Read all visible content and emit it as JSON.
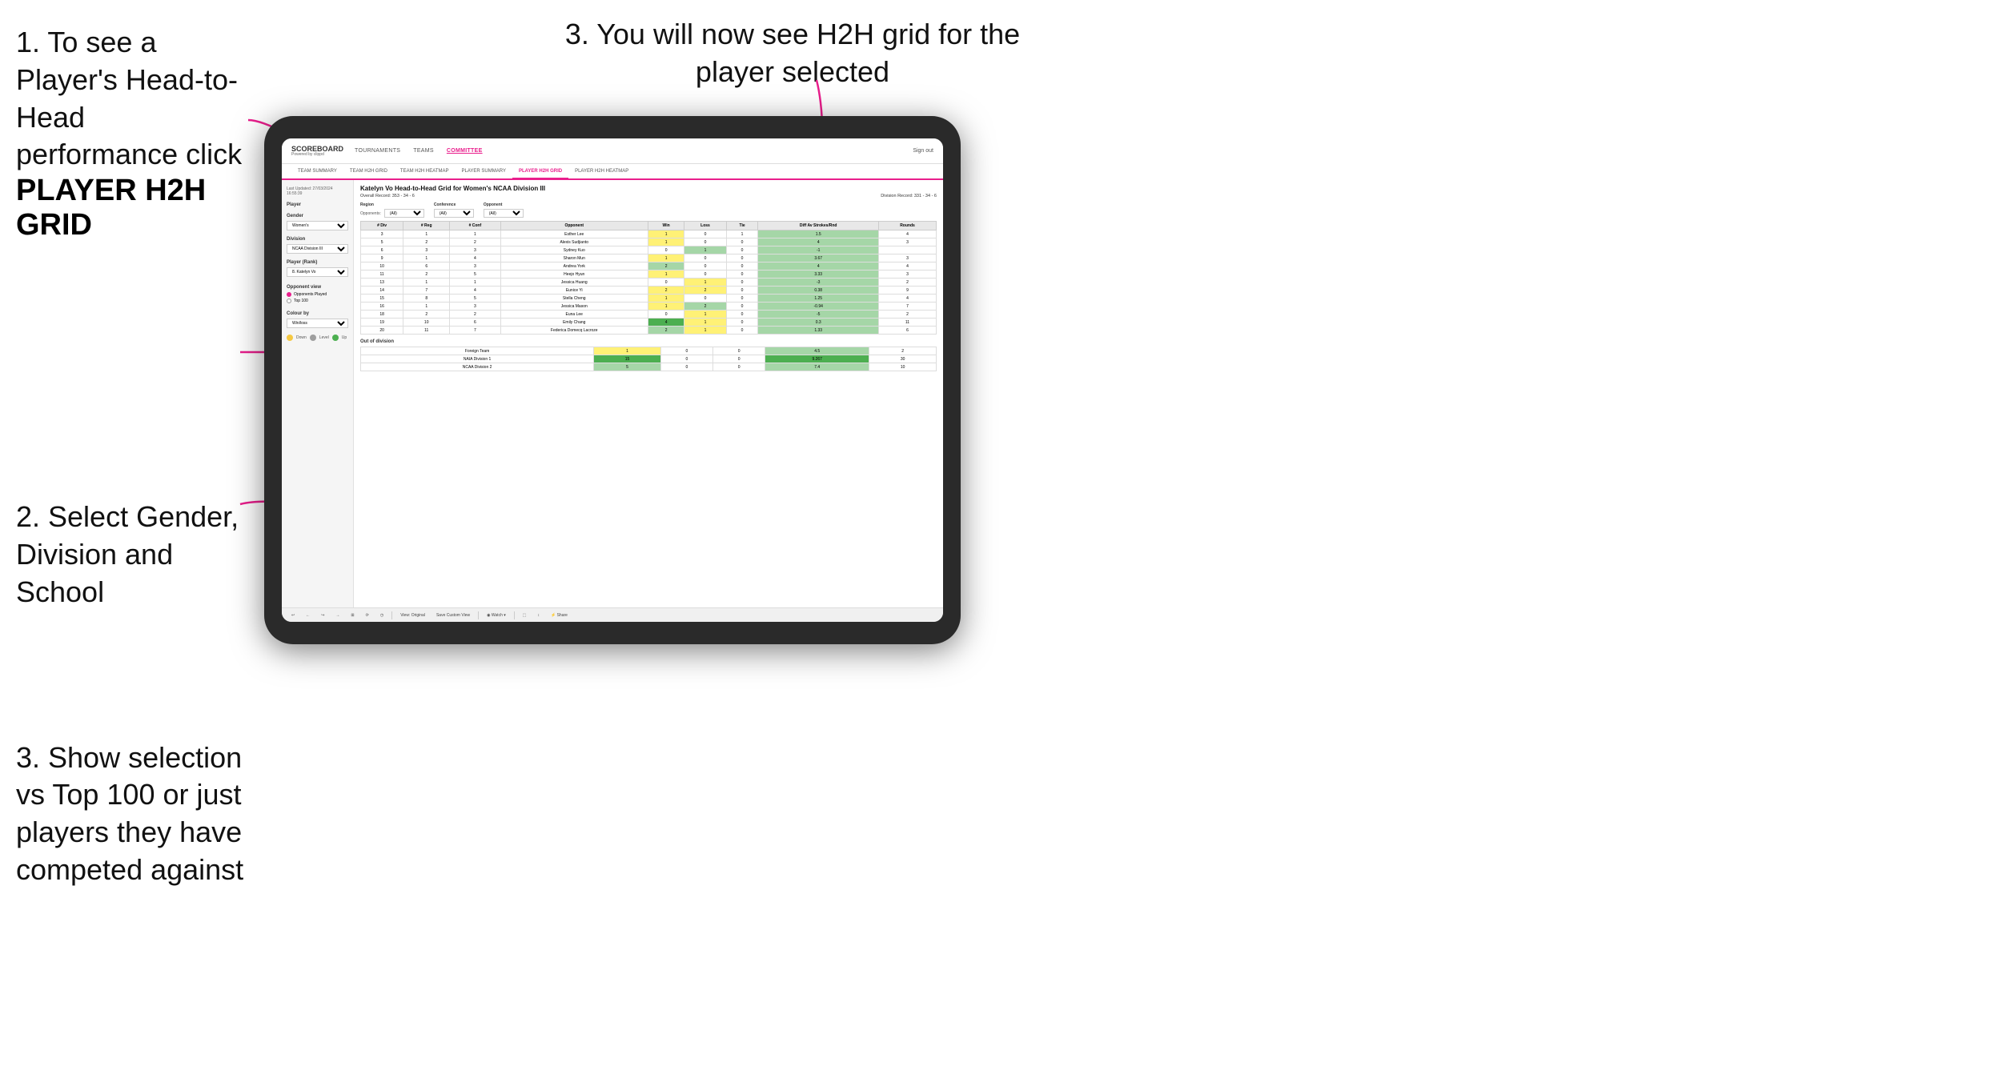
{
  "instructions": {
    "step1": {
      "text": "1. To see a Player's Head-to-Head performance click",
      "bold": "PLAYER H2H GRID"
    },
    "step2": {
      "text": "2. Select Gender, Division and School"
    },
    "step3_left": {
      "text": "3. Show selection vs Top 100 or just players they have competed against"
    },
    "step3_right": {
      "text": "3. You will now see H2H grid for the player selected"
    }
  },
  "nav": {
    "logo": "SCOREBOARD",
    "logo_sub": "Powered by clippd",
    "items": [
      "TOURNAMENTS",
      "TEAMS",
      "COMMITTEE"
    ],
    "sign_out": "Sign out"
  },
  "sub_nav": {
    "items": [
      "TEAM SUMMARY",
      "TEAM H2H GRID",
      "TEAM H2H HEATMAP",
      "PLAYER SUMMARY",
      "PLAYER H2H GRID",
      "PLAYER H2H HEATMAP"
    ],
    "active": "PLAYER H2H GRID"
  },
  "sidebar": {
    "timestamp": "Last Updated: 27/03/2024 16:55:39",
    "player_label": "Player",
    "gender_label": "Gender",
    "gender_value": "Women's",
    "division_label": "Division",
    "division_value": "NCAA Division III",
    "player_rank_label": "Player (Rank)",
    "player_rank_value": "8. Katelyn Vo",
    "opponent_view_label": "Opponent view",
    "radio_opponents": "Opponents Played",
    "radio_top100": "Top 100",
    "colour_by_label": "Colour by",
    "colour_value": "Win/loss",
    "legend_down": "Down",
    "legend_level": "Level",
    "legend_up": "Up"
  },
  "grid": {
    "title": "Katelyn Vo Head-to-Head Grid for Women's NCAA Division III",
    "overall_record": "Overall Record: 353 - 34 - 6",
    "division_record": "Division Record: 331 - 34 - 6",
    "region_label": "Region",
    "conference_label": "Conference",
    "opponent_label": "Opponent",
    "opponents_label": "Opponents:",
    "all_value": "(All)",
    "columns": {
      "div": "# Div",
      "reg": "# Reg",
      "conf": "# Conf",
      "opponent": "Opponent",
      "win": "Win",
      "loss": "Loss",
      "tie": "Tie",
      "diff": "Diff Av Strokes/Rnd",
      "rounds": "Rounds"
    },
    "rows": [
      {
        "div": 3,
        "reg": 1,
        "conf": 1,
        "opponent": "Esther Lee",
        "win": 1,
        "loss": 0,
        "tie": 1,
        "diff": 1.5,
        "rounds": 4,
        "win_color": "yellow",
        "loss_color": "white",
        "diff_color": "green_light"
      },
      {
        "div": 5,
        "reg": 2,
        "conf": 2,
        "opponent": "Alexis Sudjianto",
        "win": 1,
        "loss": 0,
        "tie": 0,
        "diff": 4.0,
        "rounds": 3,
        "win_color": "yellow",
        "loss_color": "white",
        "diff_color": "green_light"
      },
      {
        "div": 6,
        "reg": 3,
        "conf": 3,
        "opponent": "Sydney Kuo",
        "win": 0,
        "loss": 1,
        "tie": 0,
        "diff": -1.0,
        "rounds": "",
        "win_color": "white",
        "loss_color": "green_light",
        "diff_color": "red_light"
      },
      {
        "div": 9,
        "reg": 1,
        "conf": 4,
        "opponent": "Sharon Mun",
        "win": 1,
        "loss": 0,
        "tie": 0,
        "diff": 3.67,
        "rounds": 3,
        "win_color": "yellow",
        "loss_color": "white",
        "diff_color": "green_light"
      },
      {
        "div": 10,
        "reg": 6,
        "conf": 3,
        "opponent": "Andrea York",
        "win": 2,
        "loss": 0,
        "tie": 0,
        "diff": 4.0,
        "rounds": 4,
        "win_color": "green_light",
        "loss_color": "white",
        "diff_color": "green_light"
      },
      {
        "div": 11,
        "reg": 2,
        "conf": 5,
        "opponent": "Heejo Hyun",
        "win": 1,
        "loss": 0,
        "tie": 0,
        "diff": 3.33,
        "rounds": 3,
        "win_color": "yellow",
        "loss_color": "white",
        "diff_color": "green_light"
      },
      {
        "div": 13,
        "reg": 1,
        "conf": 1,
        "opponent": "Jessica Huang",
        "win": 0,
        "loss": 1,
        "tie": 0,
        "diff": -3.0,
        "rounds": 2,
        "win_color": "white",
        "loss_color": "yellow",
        "diff_color": "red_light"
      },
      {
        "div": 14,
        "reg": 7,
        "conf": 4,
        "opponent": "Eunice Yi",
        "win": 2,
        "loss": 2,
        "tie": 0,
        "diff": 0.38,
        "rounds": 9,
        "win_color": "yellow",
        "loss_color": "yellow",
        "diff_color": "green_light"
      },
      {
        "div": 15,
        "reg": 8,
        "conf": 5,
        "opponent": "Stella Cheng",
        "win": 1,
        "loss": 0,
        "tie": 0,
        "diff": 1.25,
        "rounds": 4,
        "win_color": "yellow",
        "loss_color": "white",
        "diff_color": "green_light"
      },
      {
        "div": 16,
        "reg": 1,
        "conf": 3,
        "opponent": "Jessica Mason",
        "win": 1,
        "loss": 2,
        "tie": 0,
        "diff": -0.94,
        "rounds": 7,
        "win_color": "yellow",
        "loss_color": "green_light",
        "diff_color": "red_light"
      },
      {
        "div": 18,
        "reg": 2,
        "conf": 2,
        "opponent": "Euna Lee",
        "win": 0,
        "loss": 1,
        "tie": 0,
        "diff": -5.0,
        "rounds": 2,
        "win_color": "white",
        "loss_color": "yellow",
        "diff_color": "red_light"
      },
      {
        "div": 19,
        "reg": 10,
        "conf": 6,
        "opponent": "Emily Chang",
        "win": 4,
        "loss": 1,
        "tie": 0,
        "diff": 0.3,
        "rounds": 11,
        "win_color": "green_dark",
        "loss_color": "yellow",
        "diff_color": "green_light"
      },
      {
        "div": 20,
        "reg": 11,
        "conf": 7,
        "opponent": "Federica Domecq Lacroze",
        "win": 2,
        "loss": 1,
        "tie": 0,
        "diff": 1.33,
        "rounds": 6,
        "win_color": "green_light",
        "loss_color": "yellow",
        "diff_color": "green_light"
      }
    ],
    "out_of_division": {
      "label": "Out of division",
      "rows": [
        {
          "name": "Foreign Team",
          "win": 1,
          "loss": 0,
          "tie": 0,
          "diff": 4.5,
          "rounds": 2,
          "win_color": "yellow",
          "diff_color": "green_light"
        },
        {
          "name": "NAIA Division 1",
          "win": 15,
          "loss": 0,
          "tie": 0,
          "diff": 9.267,
          "rounds": 30,
          "win_color": "green_dark",
          "diff_color": "green_dark"
        },
        {
          "name": "NCAA Division 2",
          "win": 5,
          "loss": 0,
          "tie": 0,
          "diff": 7.4,
          "rounds": 10,
          "win_color": "green_light",
          "diff_color": "green_light"
        }
      ]
    }
  },
  "toolbar": {
    "buttons": [
      "↩",
      "←",
      "↪",
      "→",
      "⊞",
      "⟳",
      "◷",
      "|",
      "View: Original",
      "Save Custom View",
      "|",
      "◉ Watch ▾",
      "|",
      "⬚",
      "↕",
      "⚡ Share"
    ]
  }
}
